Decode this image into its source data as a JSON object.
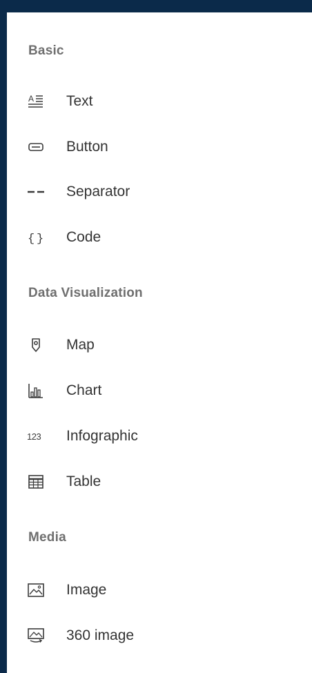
{
  "sections": [
    {
      "title": "Basic",
      "items": [
        {
          "label": "Text",
          "icon": "text-icon"
        },
        {
          "label": "Button",
          "icon": "button-icon"
        },
        {
          "label": "Separator",
          "icon": "separator-icon"
        },
        {
          "label": "Code",
          "icon": "code-icon"
        }
      ]
    },
    {
      "title": "Data Visualization",
      "items": [
        {
          "label": "Map",
          "icon": "map-pin-icon"
        },
        {
          "label": "Chart",
          "icon": "bar-chart-icon"
        },
        {
          "label": "Infographic",
          "icon": "infographic-123-icon"
        },
        {
          "label": "Table",
          "icon": "table-icon"
        }
      ]
    },
    {
      "title": "Media",
      "items": [
        {
          "label": "Image",
          "icon": "image-icon"
        },
        {
          "label": "360 image",
          "icon": "image-360-icon"
        }
      ]
    }
  ],
  "colors": {
    "frame": "#0b2a4a",
    "panel": "#ffffff",
    "section_title": "#6f6f6f",
    "item_text": "#333333",
    "icon": "#3a3a3a"
  }
}
